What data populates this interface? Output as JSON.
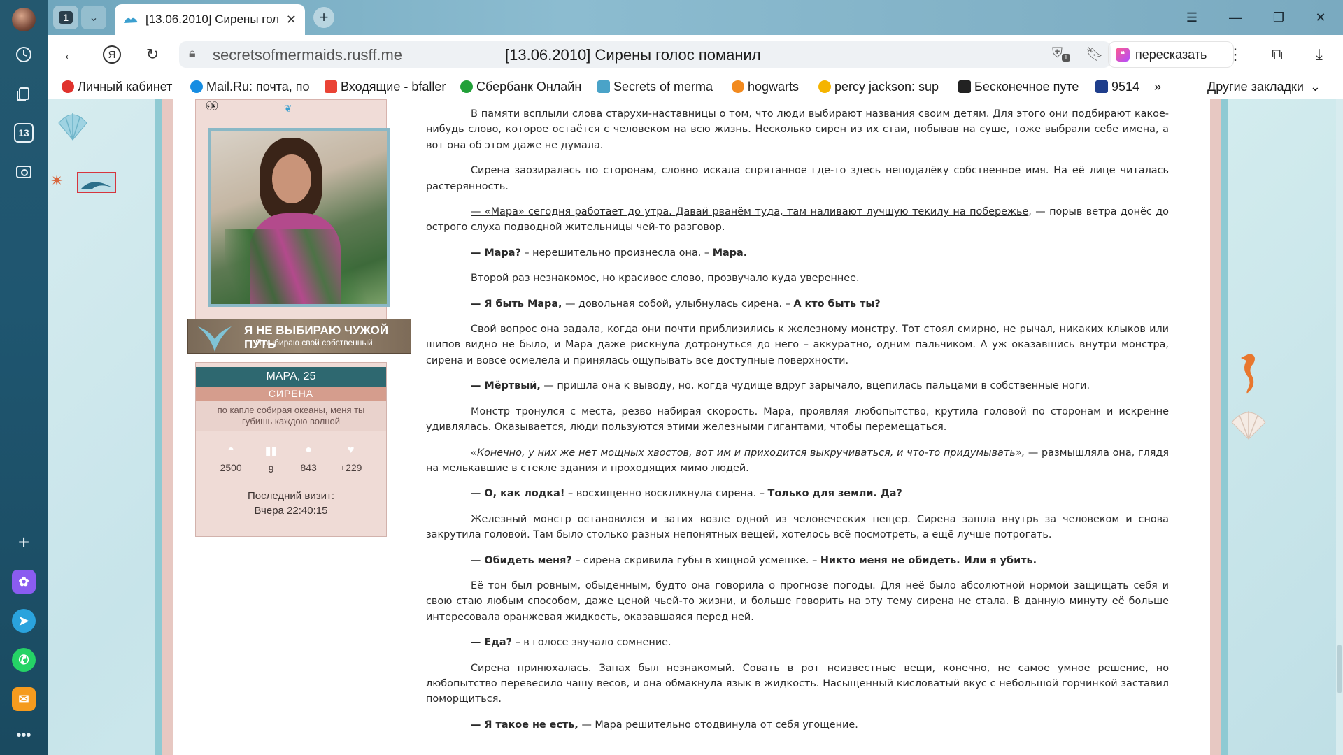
{
  "sidebar": {
    "counter_badge": "13"
  },
  "tabs": {
    "count": "1",
    "active_title": "[13.06.2010] Сирены голос поманил"
  },
  "toolbar": {
    "host": "secretsofmermaids.rusff.me",
    "page_title": "[13.06.2010] Сирены голос поманил",
    "bookmark_badge": "1",
    "retell_label": "пересказать"
  },
  "bookmarks": {
    "items": [
      {
        "label": "Личный кабинет",
        "color": "#e0322d"
      },
      {
        "label": "Mail.Ru: почта, по",
        "color": "#168de2"
      },
      {
        "label": "Входящие - bfaller",
        "color": "#ea4335"
      },
      {
        "label": "Сбербанк Онлайн",
        "color": "#21a038"
      },
      {
        "label": "Secrets of merma",
        "color": "#4aa3c8"
      },
      {
        "label": "hogwarts",
        "color": "#f28a1f"
      },
      {
        "label": "percy jackson: sup",
        "color": "#f5b400"
      },
      {
        "label": "Бесконечное путе",
        "color": "#222222"
      },
      {
        "label": "9514",
        "color": "#1f3e8c"
      }
    ],
    "other": "Другие закладки"
  },
  "profile": {
    "banner_line1": "Я НЕ ВЫБИРАЮ ЧУЖОЙ ПУТЬ",
    "banner_line2": "Я выбираю свой собственный",
    "name": "МАРА, 25",
    "race": "СИРЕНА",
    "quote": "по капле собирая океаны, меня ты губишь каждою волной",
    "stats": [
      "2500",
      "9",
      "843",
      "+229"
    ],
    "last_visit_label": "Последний визит:",
    "last_visit_value": "Вчера 22:40:15"
  },
  "post": {
    "p1": "В памяти всплыли слова старухи-наставницы о том, что люди выбирают названия своим детям. Для этого они подбирают какое-нибудь слово, которое остаётся с человеком на всю жизнь. Несколько сирен из их стаи, побывав на суше, тоже выбрали себе имена, а вот она об этом даже не думала.",
    "p2": "Сирена заозиралась по сторонам, словно искала спрятанное где-то здесь неподалёку собственное имя. На её лице читалась растерянность.",
    "p3_u": "— «Мара» сегодня работает до утра. Давай рванём туда, там наливают лучшую текилу на побережье",
    "p3_rest": ", — порыв ветра донёс до острого слуха подводной жительницы чей-то разговор.",
    "p4_b1": "— Мара?",
    "p4_mid": " – нерешительно произнесла она. – ",
    "p4_b2": "Мара.",
    "p5": "Второй раз незнакомое, но красивое слово, прозвучало куда увереннее.",
    "p6_b1": "— Я быть Мара,",
    "p6_mid": " — довольная собой, улыбнулась сирена. – ",
    "p6_b2": "А кто быть ты?",
    "p7": "Свой вопрос она задала, когда они почти приблизились к железному монстру. Тот стоял смирно, не рычал, никаких клыков или шипов видно не было, и Мара даже рискнула дотронуться до него – аккуратно, одним пальчиком. А уж оказавшись внутри монстра, сирена и вовсе осмелела и принялась ощупывать все доступные поверхности.",
    "p8_b": "— Мёртвый,",
    "p8_rest": " — пришла она к выводу, но, когда чудище вдруг зарычало, вцепилась пальцами в собственные ноги.",
    "p9": "Монстр тронулся с места, резво набирая скорость. Мара, проявляя любопытство, крутила головой по сторонам и искренне удивлялась. Оказывается, люди пользуются этими железными гигантами, чтобы перемещаться.",
    "p10_i": "«Конечно, у них же нет мощных хвостов, вот им и приходится выкручиваться, и что-то придумывать»,",
    "p10_rest": " — размышляла она, глядя на мелькавшие в стекле здания и проходящих мимо людей.",
    "p11_b1": "— О, как лодка!",
    "p11_mid": " – восхищенно воскликнула сирена. – ",
    "p11_b2": "Только для земли. Да?",
    "p12": "Железный монстр остановился и затих возле одной из человеческих пещер. Сирена зашла внутрь за человеком и снова закрутила головой. Там было столько разных непонятных вещей, хотелось всё посмотреть, а ещё лучше потрогать.",
    "p13_b1": "— Обидеть меня?",
    "p13_mid": " – сирена скривила губы в хищной усмешке. – ",
    "p13_b2": "Никто меня не обидеть. Или я убить.",
    "p14": "Её тон был ровным, обыденным, будто она говорила о прогнозе погоды. Для неё было абсолютной нормой защищать себя и свою стаю любым способом, даже ценой чьей-то жизни, и больше говорить на эту тему сирена не стала. В данную минуту её больше интересовала оранжевая жидкость, оказавшаяся перед ней.",
    "p15_b": "— Еда?",
    "p15_rest": " – в голосе звучало сомнение.",
    "p16": "Сирена принюхалась. Запах был незнакомый. Совать в рот неизвестные вещи, конечно, не самое умное решение, но любопытство перевесило чашу весов, и она обмакнула язык в жидкость. Насыщенный кисловатый вкус с небольшой горчинкой заставил поморщиться.",
    "p17_b": "— Я такое не есть,",
    "p17_rest": " — Мара решительно отодвинула от себя угощение."
  }
}
